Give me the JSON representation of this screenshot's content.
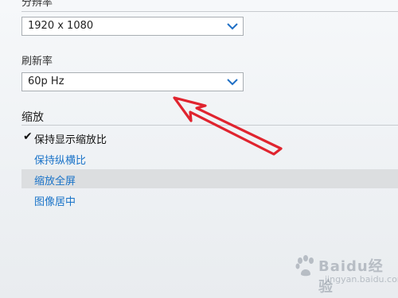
{
  "resolution": {
    "label": "分辨率",
    "value": "1920 x 1080"
  },
  "refresh_rate": {
    "label": "刷新率",
    "value": "60p Hz"
  },
  "scaling": {
    "title": "缩放",
    "items": [
      {
        "label": "保持显示缩放比",
        "checked": true
      },
      {
        "label": "保持纵横比"
      },
      {
        "label": "缩放全屏",
        "highlighted": true
      },
      {
        "label": "图像居中"
      }
    ]
  },
  "watermark": {
    "brand": "Baidu经验",
    "url": "jingyan.baidu.com"
  },
  "colors": {
    "link": "#1a73c8",
    "chevron": "#1f6fc5",
    "arrow": "#e0242f",
    "highlight": "#dcdee0"
  },
  "icons": {
    "dropdown": "chevron-down-icon",
    "check": "checkmark-icon",
    "arrow": "red-arrow-annotation"
  }
}
